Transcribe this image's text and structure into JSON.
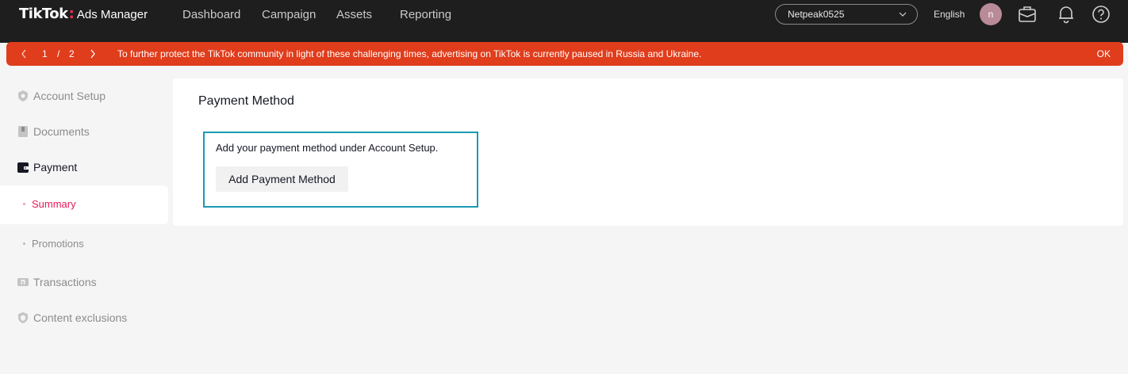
{
  "header": {
    "logo_brand": "TikTok",
    "logo_colon": ":",
    "logo_product": "Ads Manager",
    "nav": [
      "Dashboard",
      "Campaign",
      "Assets",
      "Reporting"
    ],
    "account": "Netpeak0525",
    "language": "English",
    "avatar_initial": "n",
    "icons": [
      "briefcase-icon",
      "bell-icon",
      "help-icon"
    ]
  },
  "banner": {
    "current_page": "1",
    "separator": "/",
    "total_pages": "2",
    "message": "To further protect the TikTok community in light of these challenging times, advertising on TikTok is currently paused in Russia and Ukraine.",
    "ok_label": "OK",
    "color": "#e03d1c"
  },
  "sidebar": {
    "items": [
      {
        "label": "Account Setup",
        "icon": "gear-shield-icon"
      },
      {
        "label": "Documents",
        "icon": "document-icon"
      },
      {
        "label": "Payment",
        "icon": "wallet-icon"
      },
      {
        "label": "Transactions",
        "icon": "money-icon"
      },
      {
        "label": "Content exclusions",
        "icon": "shield-icon"
      }
    ],
    "payment_sub": [
      {
        "label": "Summary"
      },
      {
        "label": "Promotions"
      }
    ]
  },
  "main": {
    "title": "Payment Method",
    "notice_text": "Add your payment method under Account Setup.",
    "add_button": "Add Payment Method"
  }
}
